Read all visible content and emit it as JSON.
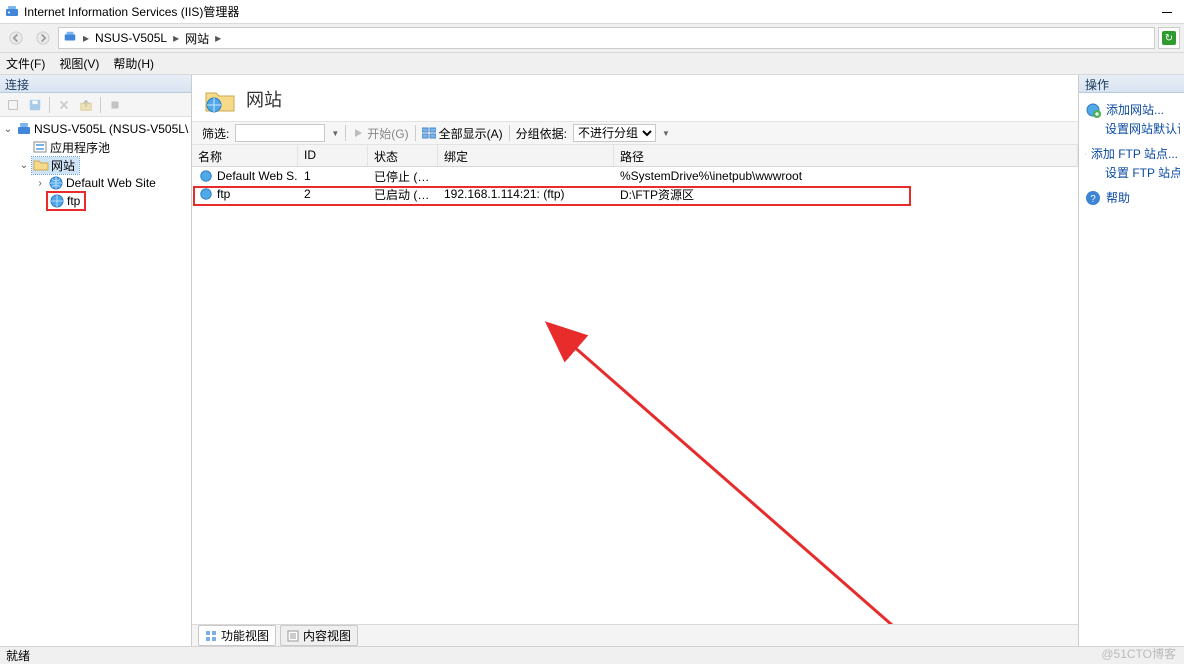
{
  "app_title": "Internet Information Services (IIS)管理器",
  "breadcrumbs": {
    "server": "NSUS-V505L",
    "node": "网站"
  },
  "menus": {
    "file": "文件(F)",
    "view": "视图(V)",
    "help": "帮助(H)"
  },
  "connections": {
    "header": "连接",
    "server_label": "NSUS-V505L (NSUS-V505L\\",
    "app_pools": "应用程序池",
    "sites": "网站",
    "default_site": "Default Web Site",
    "ftp_site": "ftp"
  },
  "page_title": "网站",
  "filter_bar": {
    "filter_label": "筛选:",
    "start_label": "开始(G)",
    "show_all": "全部显示(A)",
    "group_by_label": "分组依据:",
    "group_by_value": "不进行分组"
  },
  "columns": {
    "name": "名称",
    "id": "ID",
    "status": "状态",
    "binding": "绑定",
    "path": "路径"
  },
  "sites_rows": [
    {
      "name": "Default Web S...",
      "id": "1",
      "status": "已停止 (无)",
      "binding": "",
      "path": "%SystemDrive%\\inetpub\\wwwroot"
    },
    {
      "name": "ftp",
      "id": "2",
      "status": "已启动 (ftp)",
      "binding": "192.168.1.114:21: (ftp)",
      "path": "D:\\FTP资源区"
    }
  ],
  "bottom_tabs": {
    "features": "功能视图",
    "content": "内容视图"
  },
  "actions": {
    "header": "操作",
    "add_site": "添加网站...",
    "set_site_defaults": "设置网站默认设置",
    "add_ftp": "添加 FTP 站点...",
    "set_ftp_defaults": "设置 FTP 站点默认",
    "help": "帮助"
  },
  "status": "就绪",
  "watermark": "@51CTO博客"
}
